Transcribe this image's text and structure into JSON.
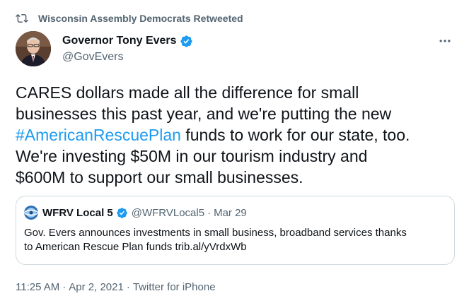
{
  "retweet": {
    "icon": "retweet-icon",
    "text": "Wisconsin Assembly Democrats Retweeted"
  },
  "author": {
    "avatar": "avatar",
    "name": "Governor Tony Evers",
    "verified_icon": "verified-badge-icon",
    "handle": "@GovEvers"
  },
  "more_icon": "more-options-icon",
  "tweet": {
    "line1": "CARES dollars made all the difference for small",
    "line2": "businesses this past year, and we're putting the new",
    "hashtag": "#AmericanRescuePlan",
    "line3_rest": " funds to work for our state, too.",
    "line4": "We're investing $50M in our tourism industry and",
    "line5": "$600M to support our small businesses."
  },
  "quote": {
    "logo": "wfrv-logo",
    "name": "WFRV Local 5",
    "handle": "@WFRVLocal5",
    "dot": "·",
    "date": "Mar 29",
    "text_line1": "Gov. Evers announces investments in small business, broadband services thanks",
    "text_line2": "to American Rescue Plan funds trib.al/yVrdxWb"
  },
  "meta": {
    "time": "11:25 AM",
    "sep1": "·",
    "date": "Apr 2, 2021",
    "sep2": "·",
    "source": "Twitter for iPhone"
  },
  "colors": {
    "accent": "#1d9bf0",
    "secondary_text": "#536471",
    "primary_text": "#0f1419",
    "border": "#cfd9de"
  }
}
